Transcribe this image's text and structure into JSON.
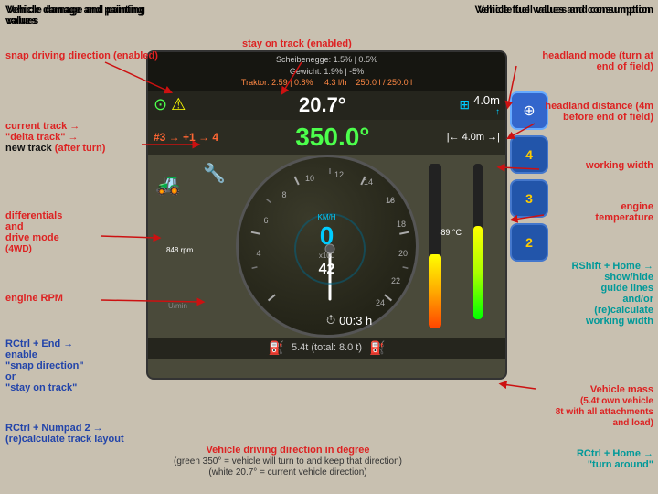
{
  "headings": {
    "top_left": "Vehicle damage and painting values",
    "top_right": "Vehicle fuel values and consumption"
  },
  "annotations": {
    "snap_driving": "snap driving direction\n(enabled)",
    "stay_on_track": "stay on track\n(enabled)",
    "headland_mode": "headland mode\n(turn at end of field)",
    "headland_distance": "headland\ndistance\n(4m before end of field)",
    "current_track": "current track →\n\"delta track\" →\nnew track (after turn)",
    "working_width": "working width",
    "differentials": "differentials\nand\ndrive mode\n(4WD)",
    "engine_temp": "engine\ntemperature",
    "engine_rpm": "engine RPM",
    "rshift_home": "RShift + Home →\nshow/hide\nguide lines\nand/or\n(re)calculate\nworking width",
    "rctrl_end": "RCtrl + End →\nenable\n\"snap direction\"\nor\n\"stay on track\"",
    "vehicle_mass": "Vehicle mass\n(5.4t own vehicle\n8t with all attachments\nand load)",
    "rctrl_numpad": "RCtrl + Numpad 2 →\n(re)calculate track layout",
    "vehicle_direction": "Vehicle driving direction in degree\n(green 350° = vehicle will turn to and keep that direction)\n(white 20.7° = current vehicle direction)",
    "rctrl_home": "RCtrl + Home →\n\"turn around\""
  },
  "dashboard": {
    "scheibenegge": "Scheibenegge: 1.5% | 0.5%",
    "gewicht": "Gewicht: 1.9% | -5%",
    "traktor": "Traktor: 2:59 | 0.8%",
    "fuel_rate": "4.3 l/h",
    "tank": "250.0 l / 250.0 l",
    "angle_white": "20.7°",
    "angle_green": "350.0°",
    "track_label": "#3 → +1 → 4",
    "working_width_val": "4.0m",
    "working_width_arrow": "↑",
    "working_width_bottom": "|← 4.0m →|",
    "speed_kmh": "KM/H",
    "speed_zero": "0",
    "speed_number": "42",
    "rpm_val": "848\nrpm",
    "temp_val": "89\n°C",
    "clock": "00:3 h",
    "mass_total": "5.4t (total: 8.0 t)",
    "buttons": [
      {
        "label": "⊕",
        "num": "",
        "active": true
      },
      {
        "label": "",
        "num": "4",
        "active": false
      },
      {
        "label": "",
        "num": "3",
        "active": false
      },
      {
        "label": "",
        "num": "2",
        "active": false
      }
    ]
  },
  "colors": {
    "red_arrow": "#cc1111",
    "blue_annotation": "#2244aa",
    "cyan_annotation": "#009999",
    "green_speed": "#00ccff",
    "green_direction": "#4cff4c"
  }
}
